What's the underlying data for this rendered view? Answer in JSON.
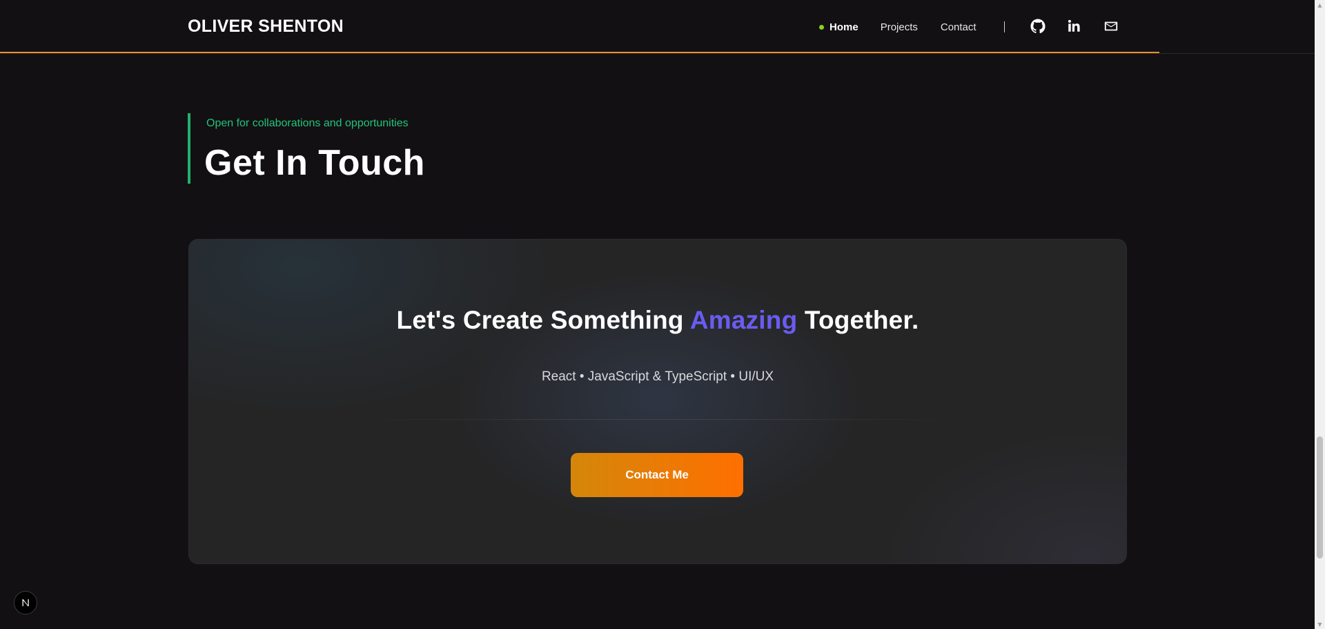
{
  "header": {
    "brand": "OLIVER SHENTON",
    "nav": [
      {
        "label": "Home",
        "active": true
      },
      {
        "label": "Projects",
        "active": false
      },
      {
        "label": "Contact",
        "active": false
      }
    ],
    "social_icons": [
      "github-icon",
      "linkedin-icon",
      "mail-icon"
    ]
  },
  "section": {
    "kicker": "Open for collaborations and opportunities",
    "title": "Get In Touch"
  },
  "card": {
    "headline_before": "Let's Create Something ",
    "headline_accent": "Amazing",
    "headline_after": " Together.",
    "skills": "React • JavaScript & TypeScript • UI/UX",
    "button_label": "Contact Me"
  },
  "badge": {
    "label": "N"
  },
  "colors": {
    "background": "#121013",
    "header_accent": "#e8922d",
    "kicker_green": "#22c37a",
    "heading_bar": "#1fb36b",
    "headline_accent": "#6a5cf0",
    "button_gradient_start": "#d4870a",
    "button_gradient_end": "#ff6f00",
    "active_dot": "#8ad21e"
  }
}
